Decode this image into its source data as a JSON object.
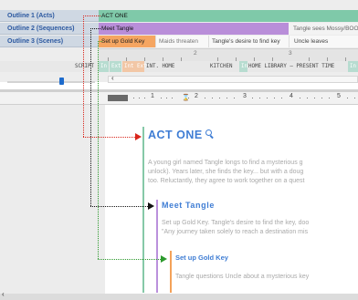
{
  "timeline": {
    "labels": [
      "Outline 1 (Acts)",
      "Outline 2 (Sequences)",
      "Outline 3 (Scenes)"
    ],
    "acts": [
      "ACT ONE"
    ],
    "sequences": [
      "Meet Tangle",
      "Tangle sees Mossy/BOO"
    ],
    "scenes": [
      "Set up Gold Key",
      "Maids threaten",
      "Tangle's desire to find key",
      "Uncle leaves"
    ],
    "ruler_numbers": [
      "2",
      "3"
    ],
    "script_row": {
      "label": "SCRIPT",
      "chip1": "In",
      "chip2": "Ext",
      "chip3": "Int Ext",
      "heading1": "INT. HOME",
      "heading2": "KITCHEN",
      "chip4": "In",
      "heading3": "HOME LIBRARY – PRESENT TIME",
      "chip5": "In"
    }
  },
  "editor": {
    "ruler_numbers": [
      "1",
      "2",
      "3",
      "4",
      "5"
    ],
    "act": {
      "heading": "ACT ONE",
      "body": [
        "A young girl named Tangle longs to find a mysterious g",
        "unlock). Years later, she finds the key... but with a doug",
        "too. Reluctantly, they agree to work together on a quest"
      ]
    },
    "sequence": {
      "heading": "Meet Tangle",
      "body": [
        "Set up Gold Key. Tangle's desire to find the key, doo",
        "\"Any journey taken solely to reach a destination mis"
      ]
    },
    "scene": {
      "heading": "Set up Gold Key",
      "body": [
        "Tangle questions Uncle about a mysterious key"
      ]
    }
  },
  "colors": {
    "act": "#86c9a8",
    "sequence": "#bb91dc",
    "scene": "#f4a259",
    "heading": "#3f7dd4",
    "connector_act": "#d9261c",
    "connector_sequence": "#111111",
    "connector_scene": "#2d9a2d"
  },
  "icons": {
    "search": "search-icon",
    "scroll_left": "chevron-left-icon"
  }
}
